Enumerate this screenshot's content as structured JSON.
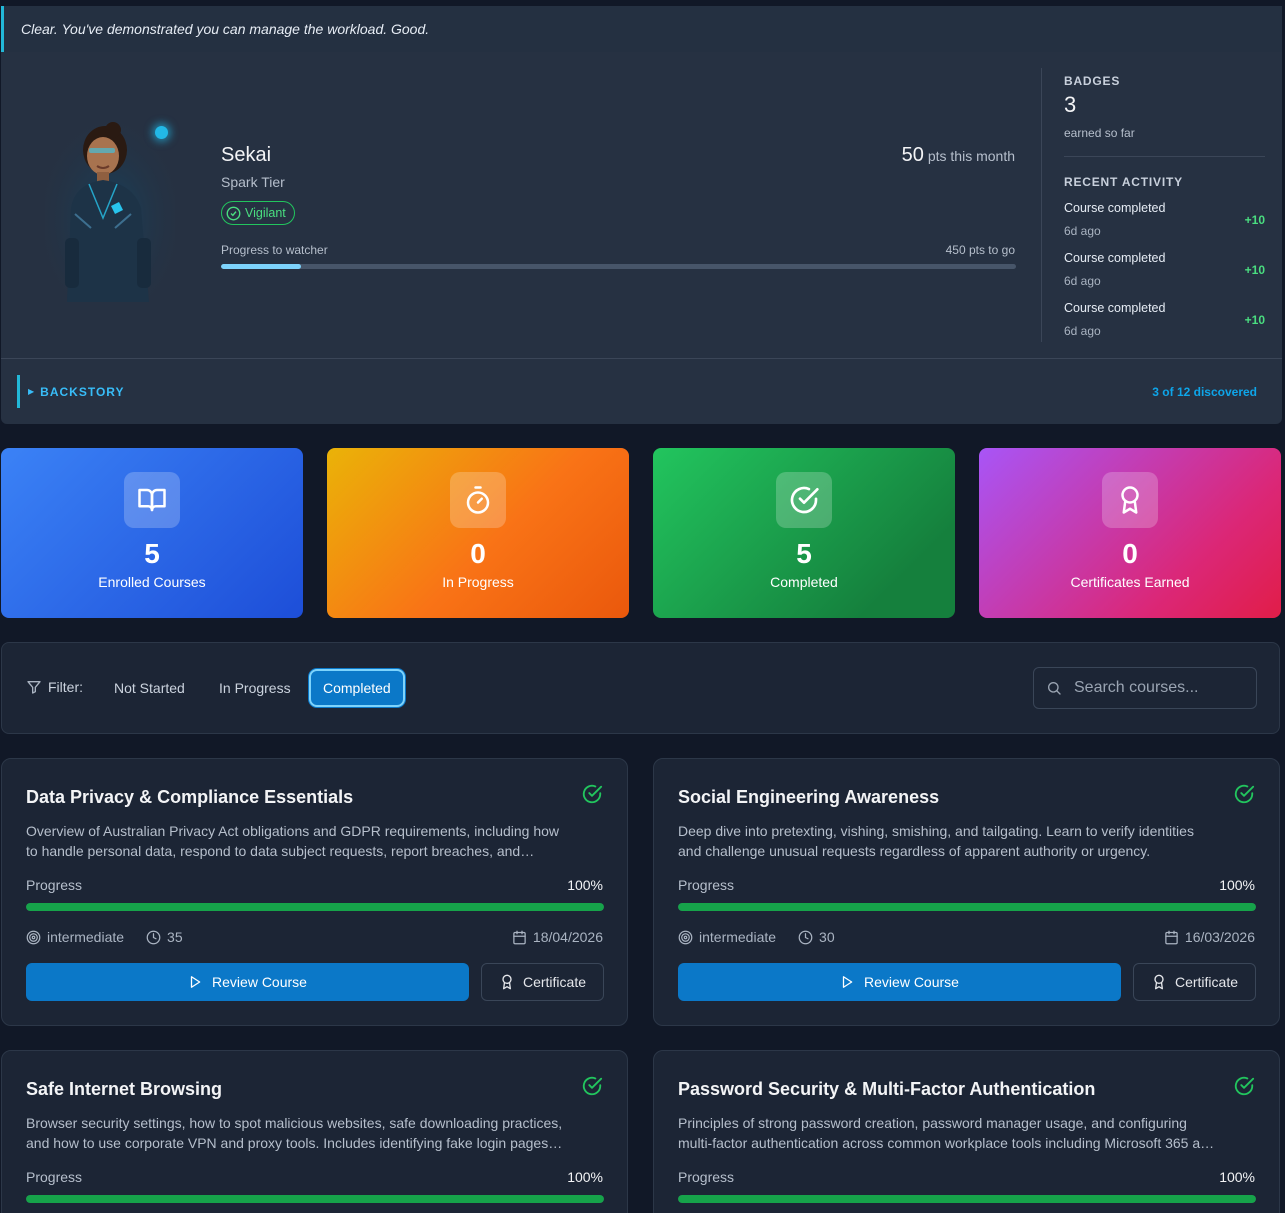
{
  "message": "Clear. You've demonstrated you can manage the workload. Good.",
  "profile": {
    "name": "Sekai",
    "tier": "Spark Tier",
    "badge": "Vigilant",
    "points": "50",
    "points_suffix": "pts this month",
    "progress_label": "Progress to watcher",
    "progress_remaining": "450 pts to go",
    "progress_fraction": 0.1
  },
  "badges": {
    "heading": "BADGES",
    "count": "3",
    "sub": "earned so far"
  },
  "activity": {
    "heading": "RECENT ACTIVITY",
    "items": [
      {
        "title": "Course completed",
        "ago": "6d ago",
        "points": "+10"
      },
      {
        "title": "Course completed",
        "ago": "6d ago",
        "points": "+10"
      },
      {
        "title": "Course completed",
        "ago": "6d ago",
        "points": "+10"
      }
    ]
  },
  "backstory": {
    "label": "BACKSTORY",
    "discovered": "3 of 12 discovered"
  },
  "stats": [
    {
      "value": "5",
      "label": "Enrolled Courses",
      "icon": "book-icon"
    },
    {
      "value": "0",
      "label": "In Progress",
      "icon": "timer-icon"
    },
    {
      "value": "5",
      "label": "Completed",
      "icon": "check-circle-icon"
    },
    {
      "value": "0",
      "label": "Certificates Earned",
      "icon": "award-icon"
    }
  ],
  "filter": {
    "label": "Filter:",
    "options": [
      "Not Started",
      "In Progress",
      "Completed"
    ],
    "active": "Completed",
    "search_placeholder": "Search courses..."
  },
  "courses": [
    {
      "title": "Data Privacy & Compliance Essentials",
      "description": "Overview of Australian Privacy Act obligations and GDPR requirements, including how to handle personal data, respond to data subject requests, report breaches, and maintain compliance in daily work.",
      "progress_label": "Progress",
      "progress_pct": "100%",
      "progress_fraction": 1.0,
      "level": "intermediate",
      "duration": "35",
      "date": "18/04/2026",
      "review_label": "Review Course",
      "cert_label": "Certificate"
    },
    {
      "title": "Social Engineering Awareness",
      "description": "Deep dive into pretexting, vishing, smishing, and tailgating. Learn to verify identities and challenge unusual requests regardless of apparent authority or urgency.",
      "progress_label": "Progress",
      "progress_pct": "100%",
      "progress_fraction": 1.0,
      "level": "intermediate",
      "duration": "30",
      "date": "16/03/2026",
      "review_label": "Review Course",
      "cert_label": "Certificate"
    },
    {
      "title": "Safe Internet Browsing",
      "description": "Browser security settings, how to spot malicious websites, safe downloading practices, and how to use corporate VPN and proxy tools. Includes identifying fake login pages and risky extensions.",
      "progress_label": "Progress",
      "progress_pct": "100%",
      "progress_fraction": 1.0
    },
    {
      "title": "Password Security & Multi-Factor Authentication",
      "description": "Principles of strong password creation, password manager usage, and configuring multi-factor authentication across common workplace tools including Microsoft 365 and other cloud services.",
      "progress_label": "Progress",
      "progress_pct": "100%",
      "progress_fraction": 1.0
    }
  ],
  "colors": {
    "accent": "#0b78c8",
    "success": "#16a34a",
    "cyan": "#22b8d8"
  }
}
